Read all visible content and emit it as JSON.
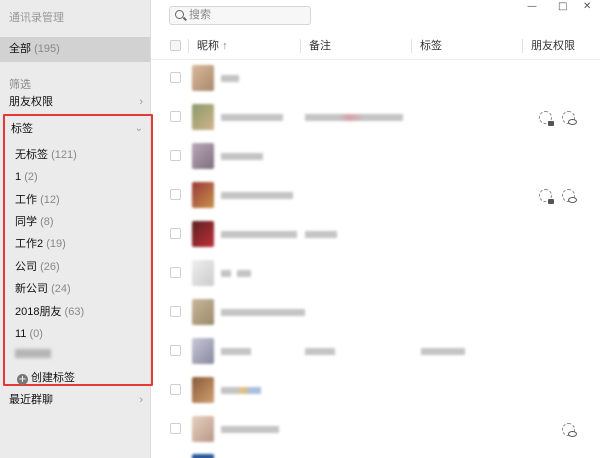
{
  "app": {
    "title": "通讯录管理"
  },
  "sidebar": {
    "all_label": "全部",
    "all_count": "(195)",
    "filter_heading": "筛选",
    "friend_permission_label": "朋友权限",
    "tags_header": "标签",
    "tags": [
      {
        "label": "无标签",
        "count": "(121)"
      },
      {
        "label": "1",
        "count": "(2)"
      },
      {
        "label": "工作",
        "count": "(12)"
      },
      {
        "label": "同学",
        "count": "(8)"
      },
      {
        "label": "工作2",
        "count": "(19)"
      },
      {
        "label": "公司",
        "count": "(26)"
      },
      {
        "label": "新公司",
        "count": "(24)"
      },
      {
        "label": "2018朋友",
        "count": "(63)"
      },
      {
        "label": "11",
        "count": "(0)"
      }
    ],
    "create_tag_label": "创建标签",
    "recent_groups_label": "最近群聊"
  },
  "search": {
    "placeholder": "搜索"
  },
  "window_controls": {
    "minimize": "—",
    "maximize": "□",
    "close": "✕"
  },
  "table": {
    "columns": {
      "nickname": "昵称",
      "sort_indicator": "↑",
      "remark": "备注",
      "tag": "标签",
      "friend_permission": "朋友权限"
    }
  },
  "icons": {
    "chevron_right": "›",
    "chevron_down": "⌄",
    "plus": "+"
  },
  "colors": {
    "highlight_border": "#e53935",
    "sidebar_bg": "#ebebeb",
    "selected_bg": "#d2d2d2"
  }
}
